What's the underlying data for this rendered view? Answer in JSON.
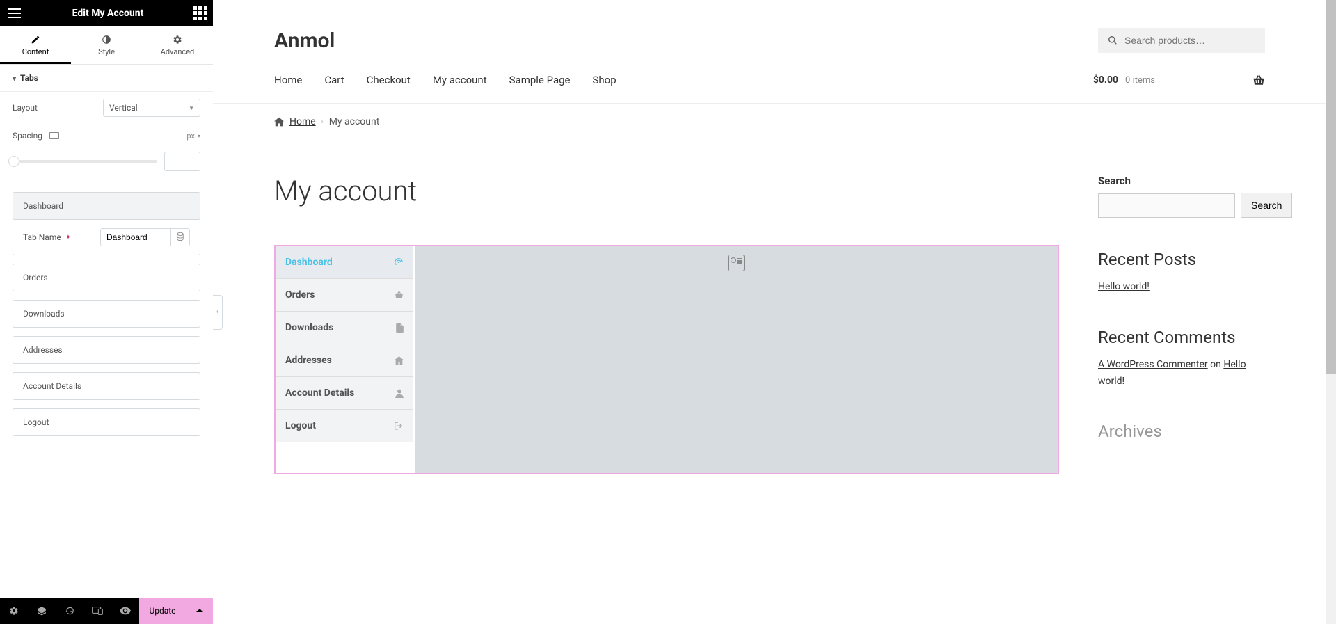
{
  "panel": {
    "title": "Edit My Account",
    "tabs": [
      {
        "label": "Content",
        "active": true
      },
      {
        "label": "Style",
        "active": false
      },
      {
        "label": "Advanced",
        "active": false
      }
    ],
    "section_header": "Tabs",
    "controls": {
      "layout_label": "Layout",
      "layout_value": "Vertical",
      "spacing_label": "Spacing",
      "spacing_unit": "px",
      "tab_name_label": "Tab Name",
      "tab_name_value": "Dashboard"
    },
    "items": [
      {
        "label": "Dashboard",
        "expanded": true
      },
      {
        "label": "Orders"
      },
      {
        "label": "Downloads"
      },
      {
        "label": "Addresses"
      },
      {
        "label": "Account Details"
      },
      {
        "label": "Logout"
      }
    ],
    "update_label": "Update"
  },
  "preview": {
    "site_title": "Anmol",
    "search_placeholder": "Search products…",
    "nav": [
      "Home",
      "Cart",
      "Checkout",
      "My account",
      "Sample Page",
      "Shop"
    ],
    "cart": {
      "price": "$0.00",
      "items": "0 items"
    },
    "breadcrumb": {
      "home": "Home",
      "current": "My account"
    },
    "page_title": "My account",
    "account_tabs": [
      {
        "label": "Dashboard",
        "active": true
      },
      {
        "label": "Orders"
      },
      {
        "label": "Downloads"
      },
      {
        "label": "Addresses"
      },
      {
        "label": "Account Details"
      },
      {
        "label": "Logout"
      }
    ],
    "sidebar": {
      "search_label": "Search",
      "search_button": "Search",
      "recent_posts_title": "Recent Posts",
      "recent_posts": [
        "Hello world!"
      ],
      "recent_comments_title": "Recent Comments",
      "comment_author": "A WordPress Commenter",
      "comment_on": " on ",
      "comment_post": "Hello world!",
      "archives_title": "Archives"
    }
  }
}
